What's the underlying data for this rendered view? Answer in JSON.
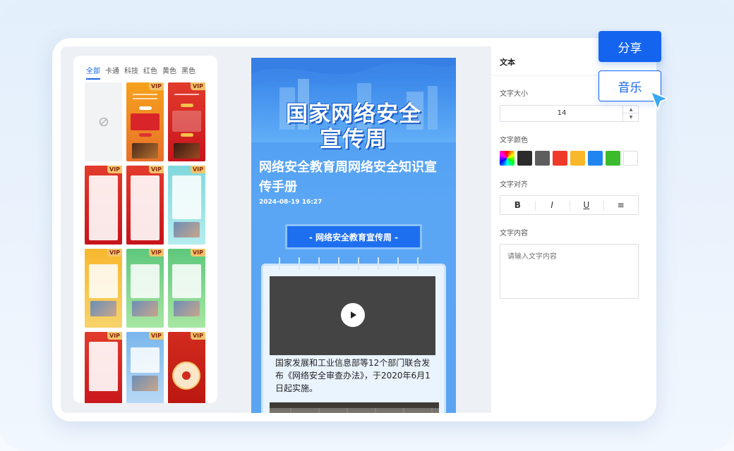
{
  "template_panel": {
    "tabs": [
      {
        "label": "全部",
        "active": true
      },
      {
        "label": "卡通",
        "active": false
      },
      {
        "label": "科技",
        "active": false
      },
      {
        "label": "红色",
        "active": false
      },
      {
        "label": "黄色",
        "active": false
      },
      {
        "label": "黑色",
        "active": false
      }
    ],
    "blank_icon": "forbidden-icon",
    "vip_label": "VIP"
  },
  "preview": {
    "title_line1": "国家网络安全",
    "title_line2": "宣传周",
    "subtitle_line1": "网络安全教育周网络安全知识宣",
    "subtitle_line2": "传手册",
    "date": "2024-08-19 16:27",
    "banner": "- 网络安全教育宣传周 -",
    "body_line1": "国家发展和工业信息部等12个部门联合发",
    "body_line2": "布《网络安全审查办法》，于2020年6月1",
    "body_line3": "日起实施。"
  },
  "properties": {
    "header": "文本",
    "font_size_label": "文字大小",
    "font_size_value": "14",
    "font_color_label": "文字颜色",
    "colors": [
      "rainbow",
      "#2b2b2b",
      "#5e5e5e",
      "#f03a2a",
      "#f9b829",
      "#1f86f0",
      "#3cbb2c",
      "#ffffff"
    ],
    "align_label": "文字对齐",
    "align_buttons": [
      "B",
      "I",
      "U",
      "≡"
    ],
    "content_label": "文字内容",
    "content_placeholder": "请输入文字内容"
  },
  "actions": {
    "share": "分享",
    "music": "音乐"
  },
  "colors": {
    "accent": "#1464f0",
    "phone_bg": "#5aa6f5"
  }
}
